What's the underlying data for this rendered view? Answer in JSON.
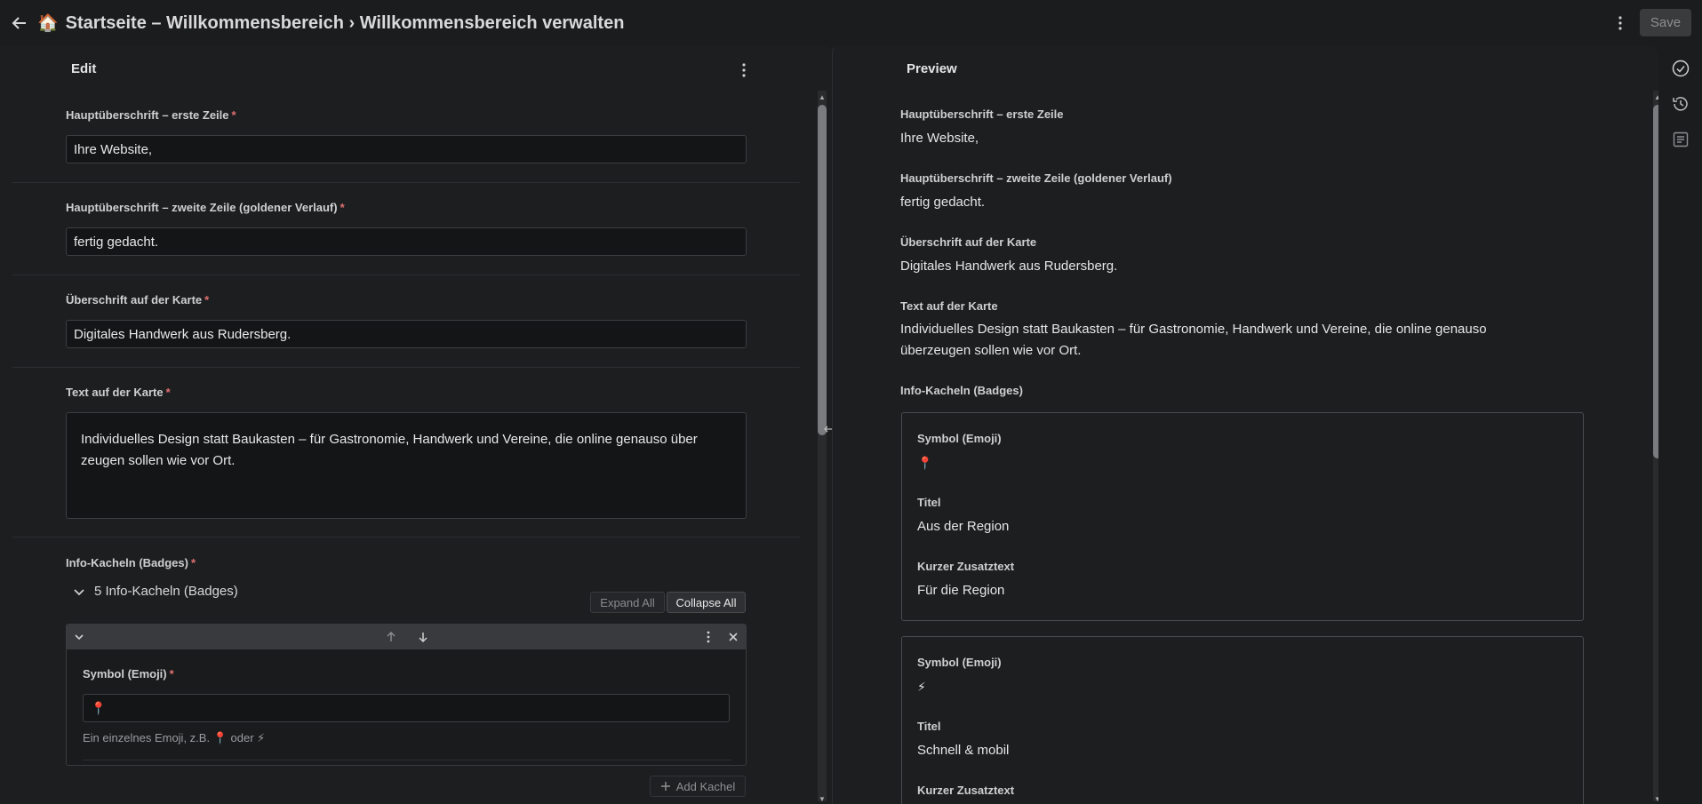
{
  "topbar": {
    "title_emoji": "🏠",
    "title": "Startseite – Willkommensbereich › Willkommensbereich verwalten",
    "save_label": "Save"
  },
  "edit": {
    "header": "Edit",
    "required_mark": "*",
    "fields": [
      {
        "label": "Hauptüberschrift – erste Zeile",
        "value": "Ihre Website,"
      },
      {
        "label": "Hauptüberschrift – zweite Zeile (goldener Verlauf)",
        "value": "fertig gedacht."
      },
      {
        "label": "Überschrift auf der Karte",
        "value": "Digitales Handwerk aus Rudersberg."
      },
      {
        "label": "Text auf der Karte",
        "value": "Individuelles Design statt Baukasten – für Gastronomie, Handwerk und Vereine, die online genauso über zeugen sollen wie vor Ort."
      }
    ],
    "badges": {
      "label": "Info-Kacheln (Badges)",
      "summary": "5 Info-Kacheln (Badges)",
      "expand_all": "Expand All",
      "collapse_all": "Collapse All",
      "item": {
        "symbol_label": "Symbol (Emoji)",
        "symbol_value": "📍",
        "hint_prefix": "Ein einzelnes Emoji, z.B.",
        "hint_emoji1": "📍",
        "hint_or": "oder",
        "hint_emoji2": "⚡"
      },
      "add_label": "Add Kachel"
    }
  },
  "preview": {
    "header": "Preview",
    "fields": [
      {
        "label": "Hauptüberschrift – erste Zeile",
        "value": "Ihre Website,"
      },
      {
        "label": "Hauptüberschrift – zweite Zeile (goldener Verlauf)",
        "value": "fertig gedacht."
      },
      {
        "label": "Überschrift auf der Karte",
        "value": "Digitales Handwerk aus Rudersberg."
      },
      {
        "label": "Text auf der Karte",
        "value": "Individuelles Design statt Baukasten – für Gastronomie, Handwerk und Vereine, die online genauso überzeugen sollen wie vor Ort."
      }
    ],
    "badges_label": "Info-Kacheln (Badges)",
    "cards": [
      {
        "symbol_label": "Symbol (Emoji)",
        "symbol": "📍",
        "title_label": "Titel",
        "title": "Aus der Region",
        "sub_label": "Kurzer Zusatztext",
        "sub": "Für die Region"
      },
      {
        "symbol_label": "Symbol (Emoji)",
        "symbol": "⚡",
        "title_label": "Titel",
        "title": "Schnell & mobil",
        "sub_label": "Kurzer Zusatztext"
      }
    ]
  }
}
